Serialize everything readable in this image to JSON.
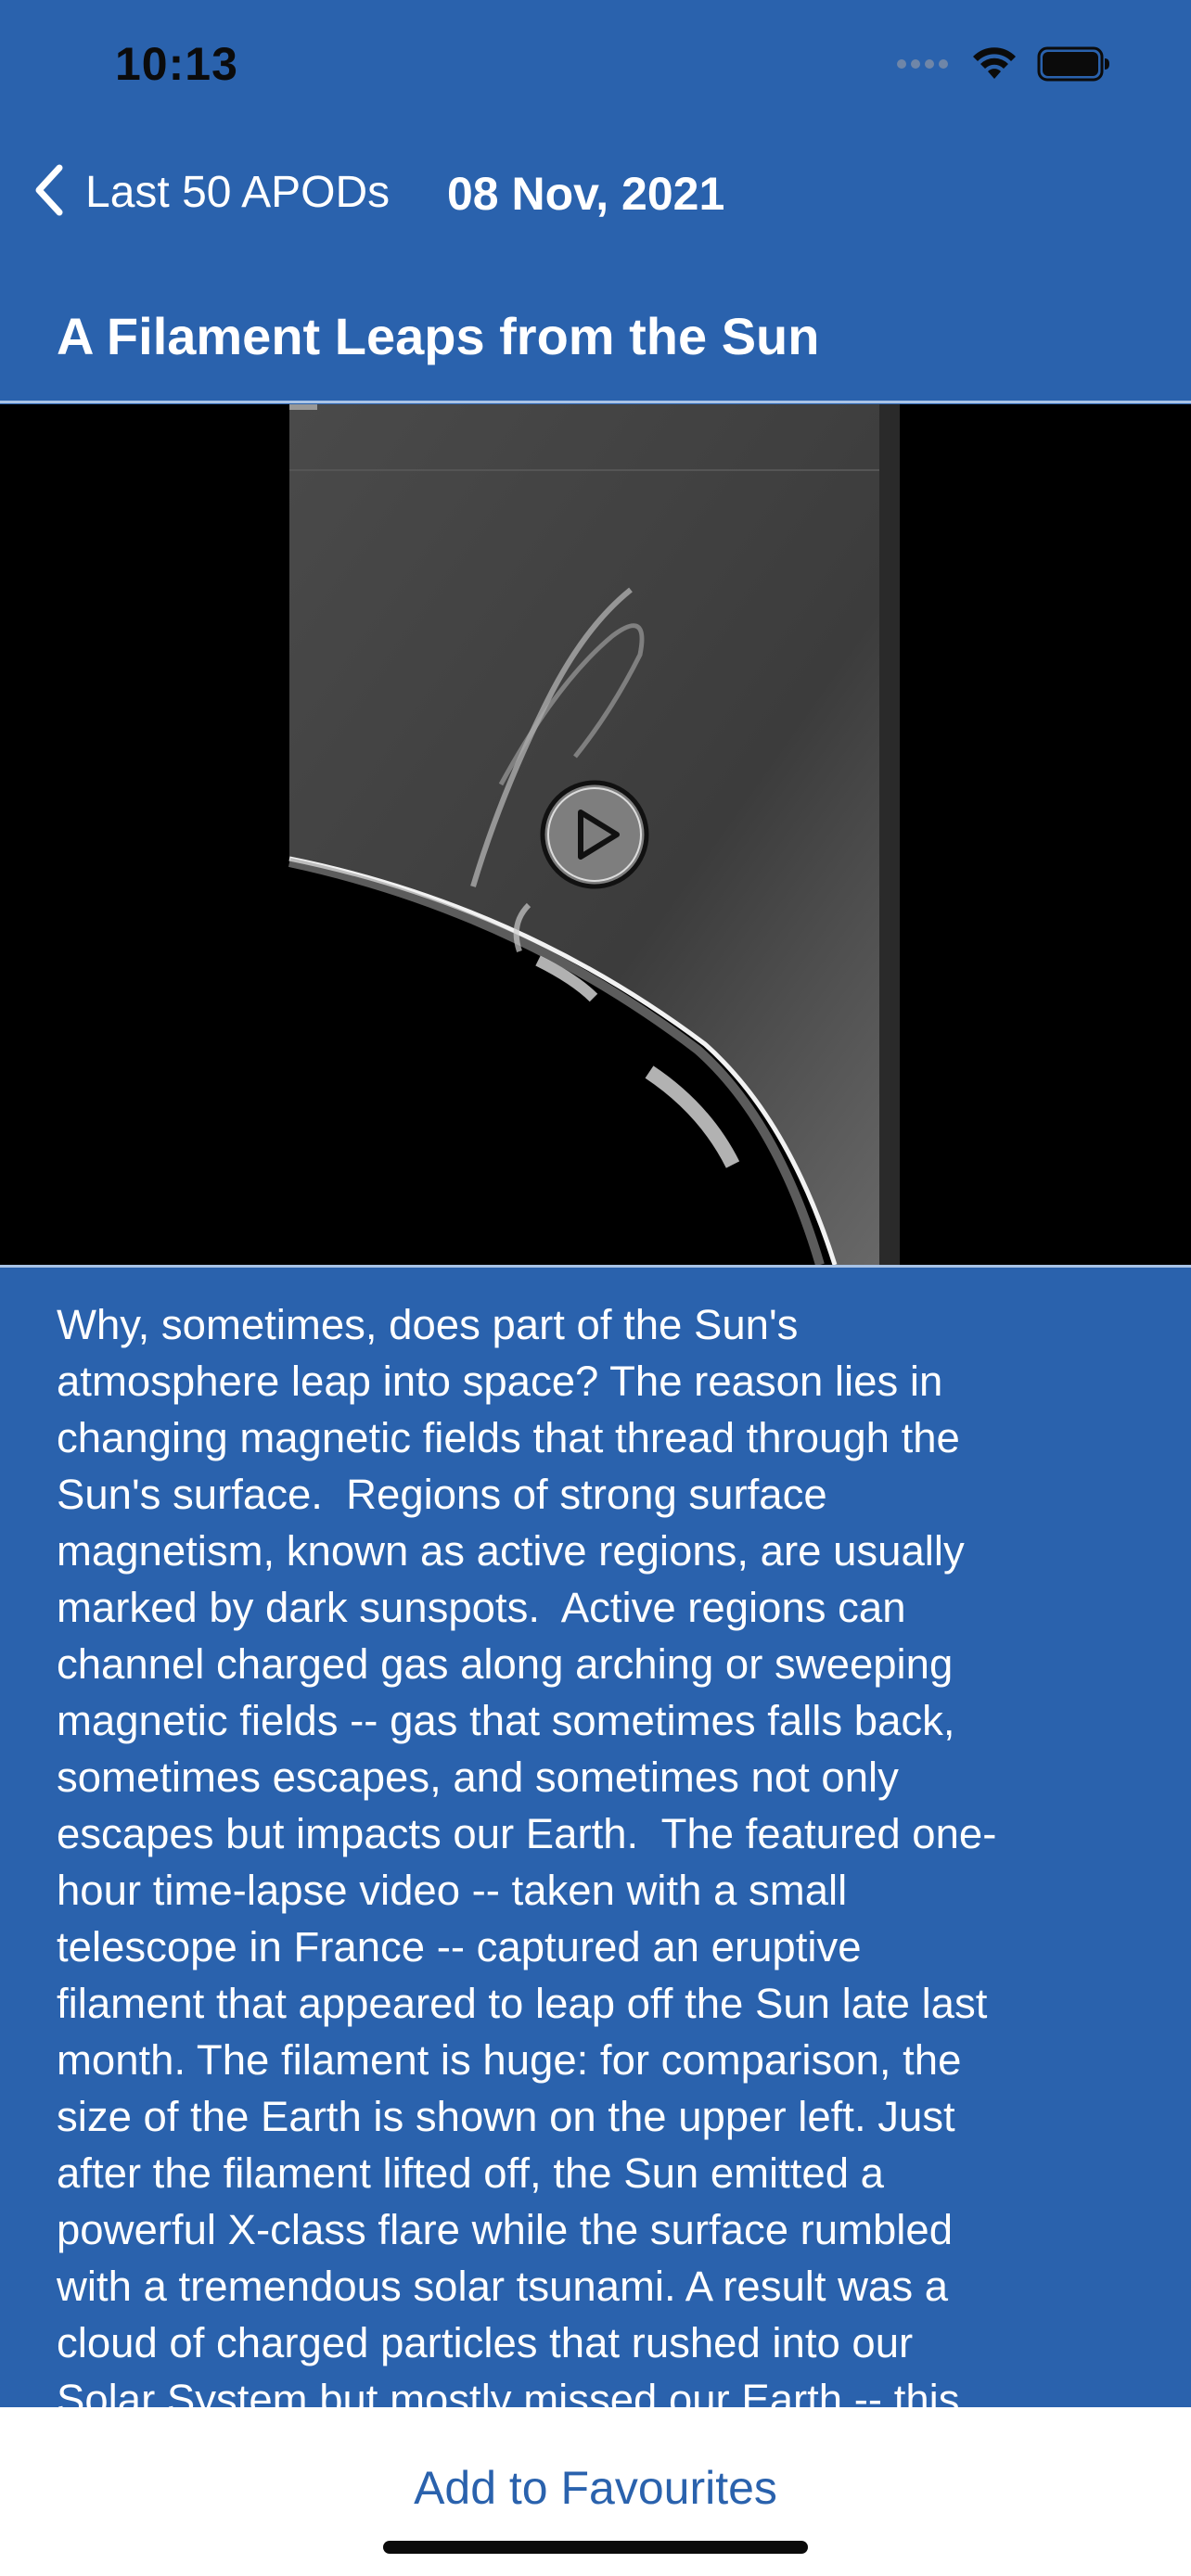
{
  "status_bar": {
    "time": "10:13",
    "signal_icon": "signal-dots-icon",
    "wifi_icon": "wifi-icon",
    "battery_icon": "battery-icon"
  },
  "nav": {
    "back_icon": "chevron-left-icon",
    "back_label": "Last 50 APODs",
    "date": "08 Nov, 2021"
  },
  "article": {
    "title": "A Filament Leaps from the Sun",
    "description": "Why, sometimes, does part of the Sun's\natmosphere leap into space? The reason lies in\nchanging magnetic fields that thread through the\nSun's surface.  Regions of strong surface\nmagnetism, known as active regions, are usually\nmarked by dark sunspots.  Active regions can\nchannel charged gas along arching or sweeping\nmagnetic fields -- gas that sometimes falls back,\nsometimes escapes, and sometimes not only\nescapes but impacts our Earth.  The featured one-\nhour time-lapse video -- taken with a small\ntelescope in France -- captured an eruptive\nfilament that appeared to leap off the Sun late last\nmonth. The filament is huge: for comparison, the\nsize of the Earth is shown on the upper left. Just\nafter the filament lifted off, the Sun emitted a\npowerful X-class flare while the surface rumbled\nwith a tremendous solar tsunami. A result was a\ncloud of charged particles that rushed into our\nSolar System but mostly missed our Earth -- this"
  },
  "video": {
    "play_icon": "play-icon"
  },
  "bottom": {
    "favourite_label": "Add to Favourites"
  },
  "colors": {
    "background": "#2a62ad",
    "divider": "#a9c3e6",
    "bottom_bar": "#ffffff",
    "accent_text": "#2a62ad"
  }
}
